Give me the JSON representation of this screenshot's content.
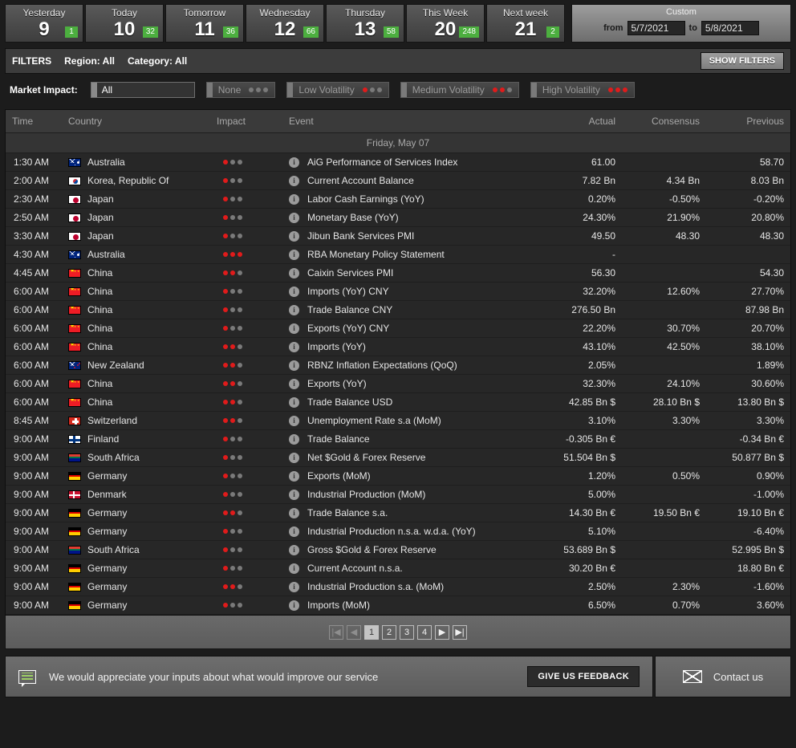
{
  "date_tabs": [
    {
      "name": "Yesterday",
      "day": "9",
      "count": "1"
    },
    {
      "name": "Today",
      "day": "10",
      "count": "32"
    },
    {
      "name": "Tomorrow",
      "day": "11",
      "count": "36"
    },
    {
      "name": "Wednesday",
      "day": "12",
      "count": "66"
    },
    {
      "name": "Thursday",
      "day": "13",
      "count": "58"
    },
    {
      "name": "This Week",
      "day": "20",
      "count": "248"
    },
    {
      "name": "Next week",
      "day": "21",
      "count": "2"
    }
  ],
  "custom_range": {
    "title": "Custom",
    "from_label": "from",
    "from_value": "5/7/2021",
    "to_label": "to",
    "to_value": "5/8/2021"
  },
  "filters_bar": {
    "title": "FILTERS",
    "region": "Region: All",
    "category": "Category: All",
    "show_filters": "SHOW FILTERS"
  },
  "market_impact": {
    "label": "Market Impact:",
    "selected": "All",
    "chips": [
      {
        "label": "None",
        "dots": [
          "gray",
          "gray",
          "gray"
        ]
      },
      {
        "label": "Low Volatility",
        "dots": [
          "red",
          "gray",
          "gray"
        ]
      },
      {
        "label": "Medium Volatility",
        "dots": [
          "red",
          "red",
          "gray"
        ]
      },
      {
        "label": "High Volatility",
        "dots": [
          "red",
          "red",
          "red"
        ]
      }
    ]
  },
  "table": {
    "headers": {
      "time": "Time",
      "country": "Country",
      "impact": "Impact",
      "event": "Event",
      "actual": "Actual",
      "consensus": "Consensus",
      "previous": "Previous"
    },
    "date_group": "Friday, May 07",
    "rows": [
      {
        "time": "1:30 AM",
        "country": "Australia",
        "flag": "au",
        "dots": [
          "red",
          "gray",
          "gray"
        ],
        "event": "AiG Performance of Services Index",
        "actual": "61.00",
        "consensus": "",
        "previous": "58.70"
      },
      {
        "time": "2:00 AM",
        "country": "Korea, Republic Of",
        "flag": "kr",
        "dots": [
          "red",
          "gray",
          "gray"
        ],
        "event": "Current Account Balance",
        "actual": "7.82 Bn",
        "consensus": "4.34 Bn",
        "previous": "8.03 Bn"
      },
      {
        "time": "2:30 AM",
        "country": "Japan",
        "flag": "jp",
        "dots": [
          "red",
          "gray",
          "gray"
        ],
        "event": "Labor Cash Earnings (YoY)",
        "actual": "0.20%",
        "consensus": "-0.50%",
        "previous": "-0.20%"
      },
      {
        "time": "2:50 AM",
        "country": "Japan",
        "flag": "jp",
        "dots": [
          "red",
          "gray",
          "gray"
        ],
        "event": "Monetary Base (YoY)",
        "actual": "24.30%",
        "consensus": "21.90%",
        "previous": "20.80%"
      },
      {
        "time": "3:30 AM",
        "country": "Japan",
        "flag": "jp",
        "dots": [
          "red",
          "gray",
          "gray"
        ],
        "event": "Jibun Bank Services PMI",
        "actual": "49.50",
        "consensus": "48.30",
        "previous": "48.30"
      },
      {
        "time": "4:30 AM",
        "country": "Australia",
        "flag": "au",
        "dots": [
          "red",
          "red",
          "red"
        ],
        "event": "RBA Monetary Policy Statement",
        "actual": "-",
        "consensus": "",
        "previous": ""
      },
      {
        "time": "4:45 AM",
        "country": "China",
        "flag": "cn",
        "dots": [
          "red",
          "red",
          "gray"
        ],
        "event": "Caixin Services PMI",
        "actual": "56.30",
        "consensus": "",
        "previous": "54.30"
      },
      {
        "time": "6:00 AM",
        "country": "China",
        "flag": "cn",
        "dots": [
          "red",
          "gray",
          "gray"
        ],
        "event": "Imports (YoY) CNY",
        "actual": "32.20%",
        "consensus": "12.60%",
        "previous": "27.70%"
      },
      {
        "time": "6:00 AM",
        "country": "China",
        "flag": "cn",
        "dots": [
          "red",
          "gray",
          "gray"
        ],
        "event": "Trade Balance CNY",
        "actual": "276.50 Bn",
        "consensus": "",
        "previous": "87.98 Bn"
      },
      {
        "time": "6:00 AM",
        "country": "China",
        "flag": "cn",
        "dots": [
          "red",
          "gray",
          "gray"
        ],
        "event": "Exports (YoY) CNY",
        "actual": "22.20%",
        "consensus": "30.70%",
        "previous": "20.70%"
      },
      {
        "time": "6:00 AM",
        "country": "China",
        "flag": "cn",
        "dots": [
          "red",
          "red",
          "gray"
        ],
        "event": "Imports (YoY)",
        "actual": "43.10%",
        "consensus": "42.50%",
        "previous": "38.10%"
      },
      {
        "time": "6:00 AM",
        "country": "New Zealand",
        "flag": "nz",
        "dots": [
          "red",
          "red",
          "gray"
        ],
        "event": "RBNZ Inflation Expectations (QoQ)",
        "actual": "2.05%",
        "consensus": "",
        "previous": "1.89%"
      },
      {
        "time": "6:00 AM",
        "country": "China",
        "flag": "cn",
        "dots": [
          "red",
          "red",
          "gray"
        ],
        "event": "Exports (YoY)",
        "actual": "32.30%",
        "consensus": "24.10%",
        "previous": "30.60%"
      },
      {
        "time": "6:00 AM",
        "country": "China",
        "flag": "cn",
        "dots": [
          "red",
          "red",
          "gray"
        ],
        "event": "Trade Balance USD",
        "actual": "42.85 Bn $",
        "consensus": "28.10 Bn $",
        "previous": "13.80 Bn $"
      },
      {
        "time": "8:45 AM",
        "country": "Switzerland",
        "flag": "ch",
        "dots": [
          "red",
          "red",
          "gray"
        ],
        "event": "Unemployment Rate s.a (MoM)",
        "actual": "3.10%",
        "consensus": "3.30%",
        "previous": "3.30%"
      },
      {
        "time": "9:00 AM",
        "country": "Finland",
        "flag": "fi",
        "dots": [
          "red",
          "gray",
          "gray"
        ],
        "event": "Trade Balance",
        "actual": "-0.305 Bn €",
        "consensus": "",
        "previous": "-0.34 Bn €"
      },
      {
        "time": "9:00 AM",
        "country": "South Africa",
        "flag": "za",
        "dots": [
          "red",
          "gray",
          "gray"
        ],
        "event": "Net $Gold & Forex Reserve",
        "actual": "51.504 Bn $",
        "consensus": "",
        "previous": "50.877 Bn $"
      },
      {
        "time": "9:00 AM",
        "country": "Germany",
        "flag": "de",
        "dots": [
          "red",
          "gray",
          "gray"
        ],
        "event": "Exports (MoM)",
        "actual": "1.20%",
        "consensus": "0.50%",
        "previous": "0.90%"
      },
      {
        "time": "9:00 AM",
        "country": "Denmark",
        "flag": "dk",
        "dots": [
          "red",
          "gray",
          "gray"
        ],
        "event": "Industrial Production (MoM)",
        "actual": "5.00%",
        "consensus": "",
        "previous": "-1.00%"
      },
      {
        "time": "9:00 AM",
        "country": "Germany",
        "flag": "de",
        "dots": [
          "red",
          "red",
          "gray"
        ],
        "event": "Trade Balance s.a.",
        "actual": "14.30 Bn €",
        "consensus": "19.50 Bn €",
        "previous": "19.10 Bn €"
      },
      {
        "time": "9:00 AM",
        "country": "Germany",
        "flag": "de",
        "dots": [
          "red",
          "gray",
          "gray"
        ],
        "event": "Industrial Production n.s.a. w.d.a. (YoY)",
        "actual": "5.10%",
        "consensus": "",
        "previous": "-6.40%"
      },
      {
        "time": "9:00 AM",
        "country": "South Africa",
        "flag": "za",
        "dots": [
          "red",
          "gray",
          "gray"
        ],
        "event": "Gross $Gold & Forex Reserve",
        "actual": "53.689 Bn $",
        "consensus": "",
        "previous": "52.995 Bn $"
      },
      {
        "time": "9:00 AM",
        "country": "Germany",
        "flag": "de",
        "dots": [
          "red",
          "gray",
          "gray"
        ],
        "event": "Current Account n.s.a.",
        "actual": "30.20 Bn €",
        "consensus": "",
        "previous": "18.80 Bn €"
      },
      {
        "time": "9:00 AM",
        "country": "Germany",
        "flag": "de",
        "dots": [
          "red",
          "red",
          "gray"
        ],
        "event": "Industrial Production s.a. (MoM)",
        "actual": "2.50%",
        "consensus": "2.30%",
        "previous": "-1.60%"
      },
      {
        "time": "9:00 AM",
        "country": "Germany",
        "flag": "de",
        "dots": [
          "red",
          "gray",
          "gray"
        ],
        "event": "Imports (MoM)",
        "actual": "6.50%",
        "consensus": "0.70%",
        "previous": "3.60%"
      }
    ]
  },
  "pagination": {
    "first": "|◀",
    "prev": "◀",
    "pages": [
      "1",
      "2",
      "3",
      "4"
    ],
    "active_page": "1",
    "next": "▶",
    "last": "▶|"
  },
  "footer": {
    "message": "We would appreciate your inputs about what would improve our service",
    "feedback_button": "GIVE US FEEDBACK",
    "contact": "Contact us"
  },
  "colors": {
    "badge_green": "#4caf3f",
    "impact_red": "#e01b1b",
    "impact_gray": "#7a7a7a",
    "background": "#1c1c1c"
  }
}
